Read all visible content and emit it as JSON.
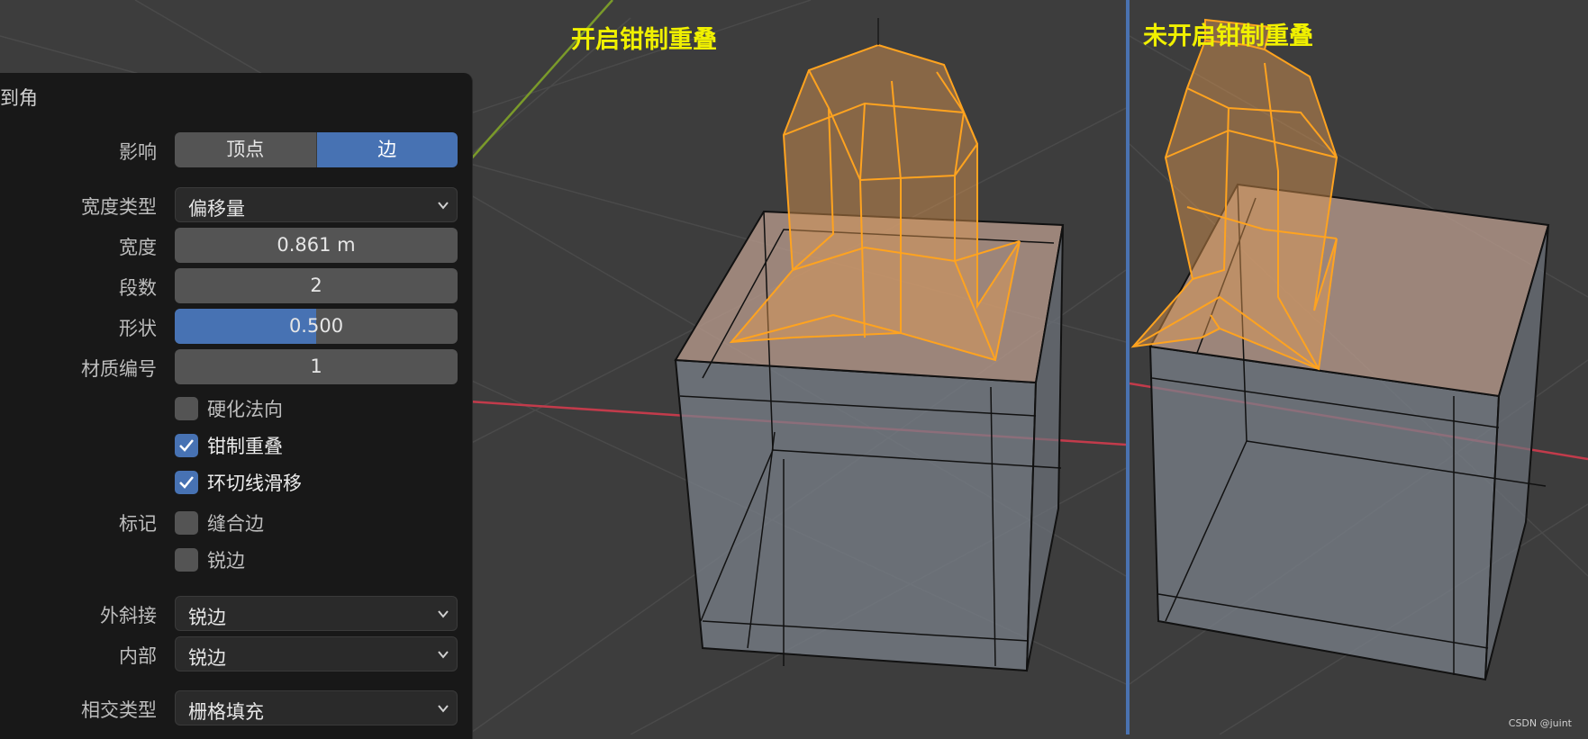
{
  "viewports": {
    "left_title": "开启钳制重叠",
    "right_title": "未开启钳制重叠"
  },
  "panel": {
    "title": "到角",
    "affect": {
      "label": "影响",
      "options": [
        "顶点",
        "边"
      ],
      "selected": "边"
    },
    "width_type": {
      "label": "宽度类型",
      "value": "偏移量"
    },
    "width": {
      "label": "宽度",
      "value": "0.861 m"
    },
    "segments": {
      "label": "段数",
      "value": "2"
    },
    "shape": {
      "label": "形状",
      "value": "0.500",
      "fraction": 0.5
    },
    "material_index": {
      "label": "材质编号",
      "value": "1"
    },
    "harden_normals": {
      "label": "硬化法向",
      "checked": false
    },
    "clamp_overlap": {
      "label": "钳制重叠",
      "checked": true
    },
    "loop_slide": {
      "label": "环切线滑移",
      "checked": true
    },
    "mark": {
      "label": "标记",
      "seam": {
        "label": "缝合边",
        "checked": false
      },
      "sharp": {
        "label": "锐边",
        "checked": false
      }
    },
    "miter_outer": {
      "label": "外斜接",
      "value": "锐边"
    },
    "miter_inner": {
      "label": "内部",
      "value": "锐边"
    },
    "intersection_type": {
      "label": "相交类型",
      "value": "栅格填充"
    }
  },
  "watermark": "CSDN @juint",
  "colors": {
    "accent": "#4772b3",
    "title_text": "#f0f000",
    "mesh_selected": "#ffa31f",
    "axis_x": "#c23b4b",
    "axis_y": "#7a9a2a"
  }
}
